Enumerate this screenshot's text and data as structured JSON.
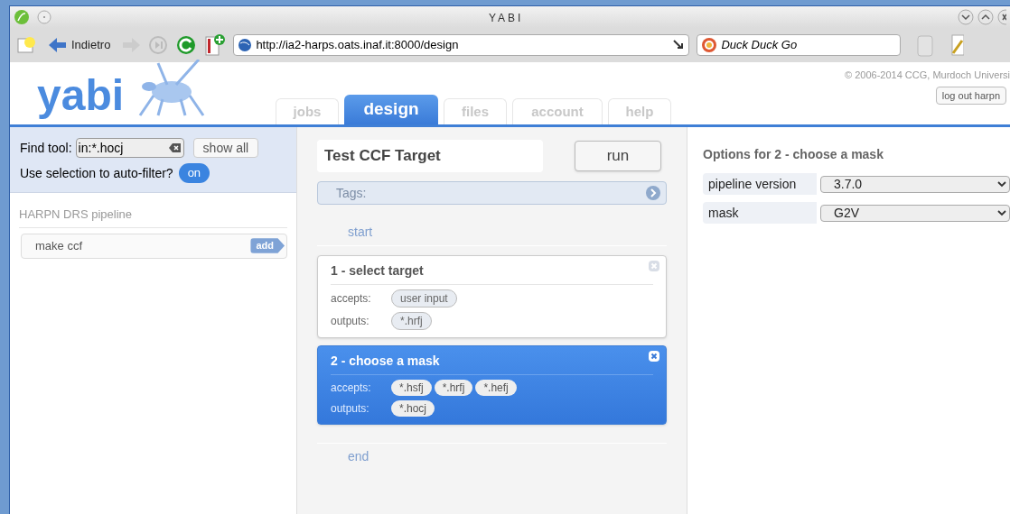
{
  "window": {
    "title": "YABI"
  },
  "toolbar": {
    "back_label": "Indietro",
    "url": "http://ia2-harps.oats.inaf.it:8000/design",
    "search_engine": "Duck Duck Go"
  },
  "header": {
    "logo": "yabi",
    "copyright": "© 2006-2014 CCG, Murdoch Universi",
    "logout": "log out harpn"
  },
  "tabs": [
    {
      "label": "jobs",
      "selected": false
    },
    {
      "label": "design",
      "selected": true
    },
    {
      "label": "files",
      "selected": false
    },
    {
      "label": "account",
      "selected": false
    },
    {
      "label": "help",
      "selected": false
    }
  ],
  "tool_search": {
    "label": "Find tool:",
    "value": "in:*.hocj",
    "show_all": "show all",
    "auto_filter_label": "Use selection to auto-filter?",
    "auto_filter": "on"
  },
  "tool_groups": [
    {
      "name": "HARPN DRS pipeline",
      "tools": [
        {
          "name": "make ccf",
          "add": "add"
        }
      ]
    }
  ],
  "workflow": {
    "name": "Test CCF Target",
    "run": "run",
    "tags_placeholder": "Tags:",
    "start": "start",
    "end": "end",
    "steps": [
      {
        "title": "1 - select target",
        "selected": false,
        "accepts_label": "accepts:",
        "accepts": [
          "user input"
        ],
        "outputs_label": "outputs:",
        "outputs": [
          "*.hrfj"
        ]
      },
      {
        "title": "2 - choose a mask",
        "selected": true,
        "accepts_label": "accepts:",
        "accepts": [
          "*.hsfj",
          "*.hrfj",
          "*.hefj"
        ],
        "outputs_label": "outputs:",
        "outputs": [
          "*.hocj"
        ]
      }
    ]
  },
  "options": {
    "title": "Options for 2 - choose a mask",
    "fields": [
      {
        "label": "pipeline version",
        "value": "3.7.0"
      },
      {
        "label": "mask",
        "value": "G2V"
      }
    ]
  }
}
